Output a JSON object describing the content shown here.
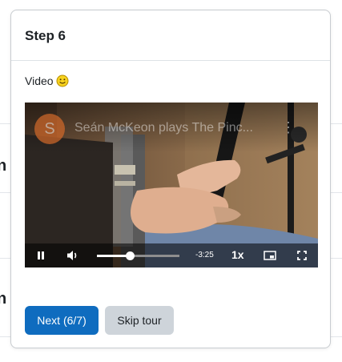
{
  "background": {
    "letters": [
      "n",
      "n"
    ]
  },
  "step": {
    "title": "Step 6",
    "body_text": "Video",
    "emoji": "smiley-icon"
  },
  "video": {
    "channel_initial": "S",
    "title": "Seán McKeon plays The Pinc...",
    "time_remaining": "-3:25",
    "speed": "1x",
    "progress": 0.4,
    "icons": [
      "pause-icon",
      "volume-icon",
      "more-icon",
      "pip-icon",
      "fullscreen-icon"
    ]
  },
  "buttons": {
    "next": "Next (6/7)",
    "skip": "Skip tour"
  },
  "colors": {
    "primary": "#0f6cbf",
    "secondary": "#ced4da",
    "border": "#c8ccd0"
  }
}
